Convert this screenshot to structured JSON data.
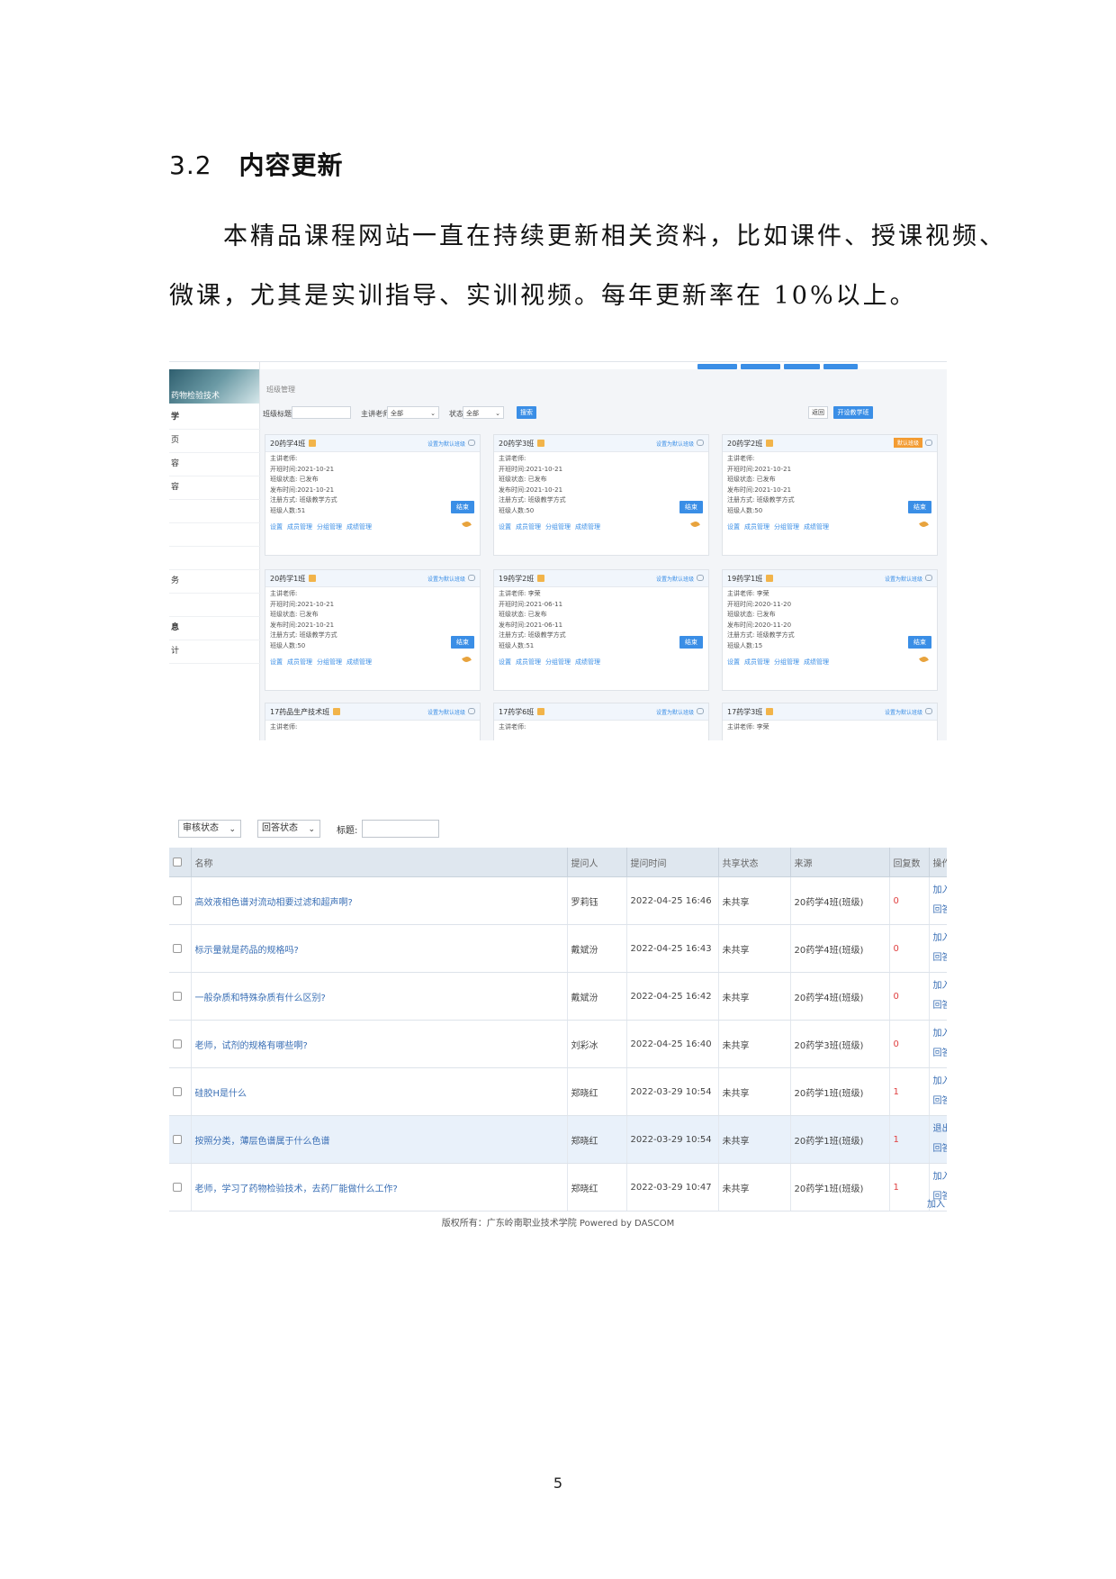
{
  "heading": {
    "number": "3.2",
    "title": "内容更新"
  },
  "paragraph": {
    "line1": "本精品课程网站一直在持续更新相关资料，比如课件、授课视频、",
    "line2": "微课，尤其是实训指导、实训视频。每年更新率在 10%以上。"
  },
  "screenshot1": {
    "logo_text": "药物检验技术",
    "nav_items": [
      "学",
      "页",
      "容",
      "容",
      "务",
      "息",
      "计"
    ],
    "breadcrumb": "班级管理",
    "filter": {
      "title_label": "班级标题:",
      "teacher_label": "主讲老师:",
      "teacher_value": "全部",
      "status_label": "状态:",
      "status_value": "全部",
      "search_button": "搜索",
      "back_button": "返回",
      "create_button": "开设教学班"
    },
    "set_default": "设置为默认班级",
    "is_default": "默认班级",
    "end_button": "结束",
    "card_links": [
      "设置",
      "成员管理",
      "分组管理",
      "成绩管理"
    ],
    "cards": [
      {
        "name": "20药学4班",
        "teacher": "主讲老师:",
        "l2": "开班时间:2021-10-21",
        "l3": "班级状态: 已发布",
        "l4": "发布时间:2021-10-21",
        "l5": "注册方式: 班级教学方式",
        "l6": "班级人数:51"
      },
      {
        "name": "20药学3班",
        "teacher": "主讲老师:",
        "l2": "开班时间:2021-10-21",
        "l3": "班级状态: 已发布",
        "l4": "发布时间:2021-10-21",
        "l5": "注册方式: 班级教学方式",
        "l6": "班级人数:50"
      },
      {
        "name": "20药学2班",
        "teacher": "主讲老师:",
        "l2": "开班时间:2021-10-21",
        "l3": "班级状态: 已发布",
        "l4": "发布时间:2021-10-21",
        "l5": "注册方式: 班级教学方式",
        "l6": "班级人数:50"
      },
      {
        "name": "20药学1班",
        "teacher": "主讲老师:",
        "l2": "开班时间:2021-10-21",
        "l3": "班级状态: 已发布",
        "l4": "发布时间:2021-10-21",
        "l5": "注册方式: 班级教学方式",
        "l6": "班级人数:50"
      },
      {
        "name": "19药学2班",
        "teacher": "主讲老师: 李荣",
        "l2": "开班时间:2021-06-11",
        "l3": "班级状态: 已发布",
        "l4": "发布时间:2021-06-11",
        "l5": "注册方式: 班级教学方式",
        "l6": "班级人数:51"
      },
      {
        "name": "19药学1班",
        "teacher": "主讲老师: 李荣",
        "l2": "开班时间:2020-11-20",
        "l3": "班级状态: 已发布",
        "l4": "发布时间:2020-11-20",
        "l5": "注册方式: 班级教学方式",
        "l6": "班级人数:15"
      },
      {
        "name": "17药品生产技术班",
        "teacher": "主讲老师:"
      },
      {
        "name": "17药学6班",
        "teacher": "主讲老师:"
      },
      {
        "name": "17药学3班",
        "teacher": "主讲老师: 李荣"
      }
    ]
  },
  "screenshot2": {
    "filter": {
      "review_status": "审核状态",
      "answer_status": "回答状态",
      "title_label": "标题:"
    },
    "columns": [
      "名称",
      "提问人",
      "提问时间",
      "共享状态",
      "来源",
      "回复数",
      "操作"
    ],
    "rows": [
      {
        "title": "高效液相色谱对流动相要过滤和超声啊?",
        "asker": "罗莉钰",
        "time": "2022-04-25 16:46",
        "share": "未共享",
        "source": "20药学4班(班级)",
        "replies": "0",
        "op1": "加入",
        "op2": "回答"
      },
      {
        "title": "标示量就是药品的规格吗?",
        "asker": "戴斌汾",
        "time": "2022-04-25 16:43",
        "share": "未共享",
        "source": "20药学4班(班级)",
        "replies": "0",
        "op1": "加入",
        "op2": "回答"
      },
      {
        "title": "一般杂质和特殊杂质有什么区别?",
        "asker": "戴斌汾",
        "time": "2022-04-25 16:42",
        "share": "未共享",
        "source": "20药学4班(班级)",
        "replies": "0",
        "op1": "加入",
        "op2": "回答"
      },
      {
        "title": "老师，试剂的规格有哪些啊?",
        "asker": "刘彩冰",
        "time": "2022-04-25 16:40",
        "share": "未共享",
        "source": "20药学3班(班级)",
        "replies": "0",
        "op1": "加入",
        "op2": "回答"
      },
      {
        "title": "硅胶H是什么",
        "asker": "郑晓红",
        "time": "2022-03-29 10:54",
        "share": "未共享",
        "source": "20药学1班(班级)",
        "replies": "1",
        "op1": "加入",
        "op2": "回答"
      },
      {
        "title": "按照分类，薄层色谱属于什么色谱",
        "asker": "郑晓红",
        "time": "2022-03-29 10:54",
        "share": "未共享",
        "source": "20药学1班(班级)",
        "replies": "1",
        "op1": "退出",
        "op2": "回答"
      },
      {
        "title": "老师，学习了药物检验技术，去药厂能做什么工作?",
        "asker": "郑晓红",
        "time": "2022-03-29 10:47",
        "share": "未共享",
        "source": "20药学1班(班级)",
        "replies": "1",
        "op1": "加入",
        "op2": "回答"
      }
    ],
    "partial_op": "加入",
    "footer": "版权所有：广东岭南职业技术学院 Powered by DASCOM"
  },
  "page_number": "5",
  "colors": {
    "accent_blue": "#3a8ee6",
    "reply_red": "#e04040",
    "header_bg": "#dfe7ef"
  }
}
